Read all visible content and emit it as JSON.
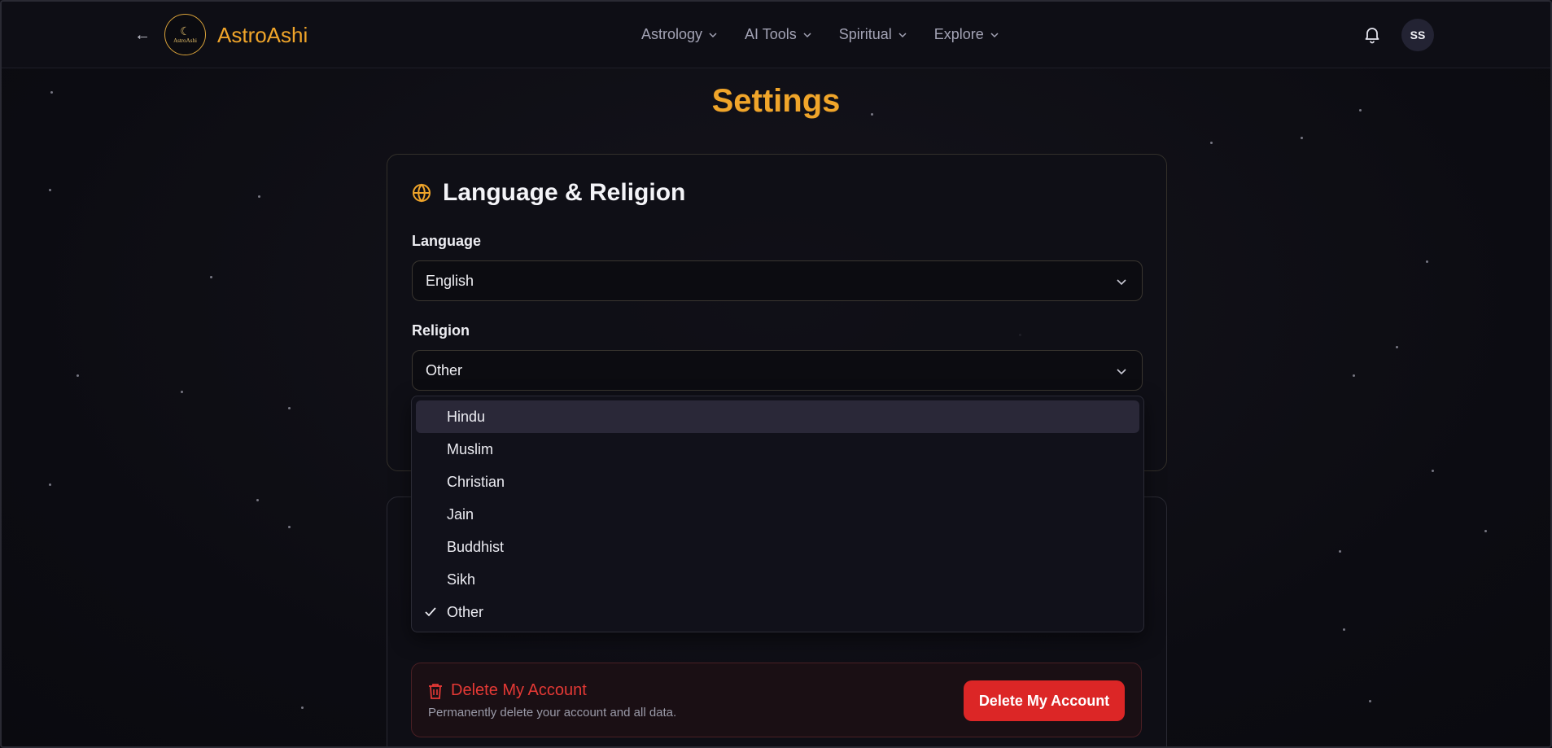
{
  "header": {
    "brand": "AstroAshi",
    "logo_text": "AstroAshi",
    "nav": [
      {
        "label": "Astrology"
      },
      {
        "label": "AI Tools"
      },
      {
        "label": "Spiritual"
      },
      {
        "label": "Explore"
      }
    ],
    "avatar_initials": "SS"
  },
  "page_title": "Settings",
  "language_religion": {
    "title": "Language & Religion",
    "language_label": "Language",
    "language_value": "English",
    "religion_label": "Religion",
    "religion_value": "Other"
  },
  "religion_dropdown": {
    "options": [
      "Hindu",
      "Muslim",
      "Christian",
      "Jain",
      "Buddhist",
      "Sikh",
      "Other"
    ],
    "highlighted": "Hindu",
    "selected": "Other"
  },
  "danger_zone": {
    "title": "Delete My Account",
    "description": "Permanently delete your account and all data.",
    "button_label": "Delete My Account"
  },
  "colors": {
    "accent": "#f0a52a",
    "danger": "#dc2626",
    "background": "#0d0d14"
  }
}
